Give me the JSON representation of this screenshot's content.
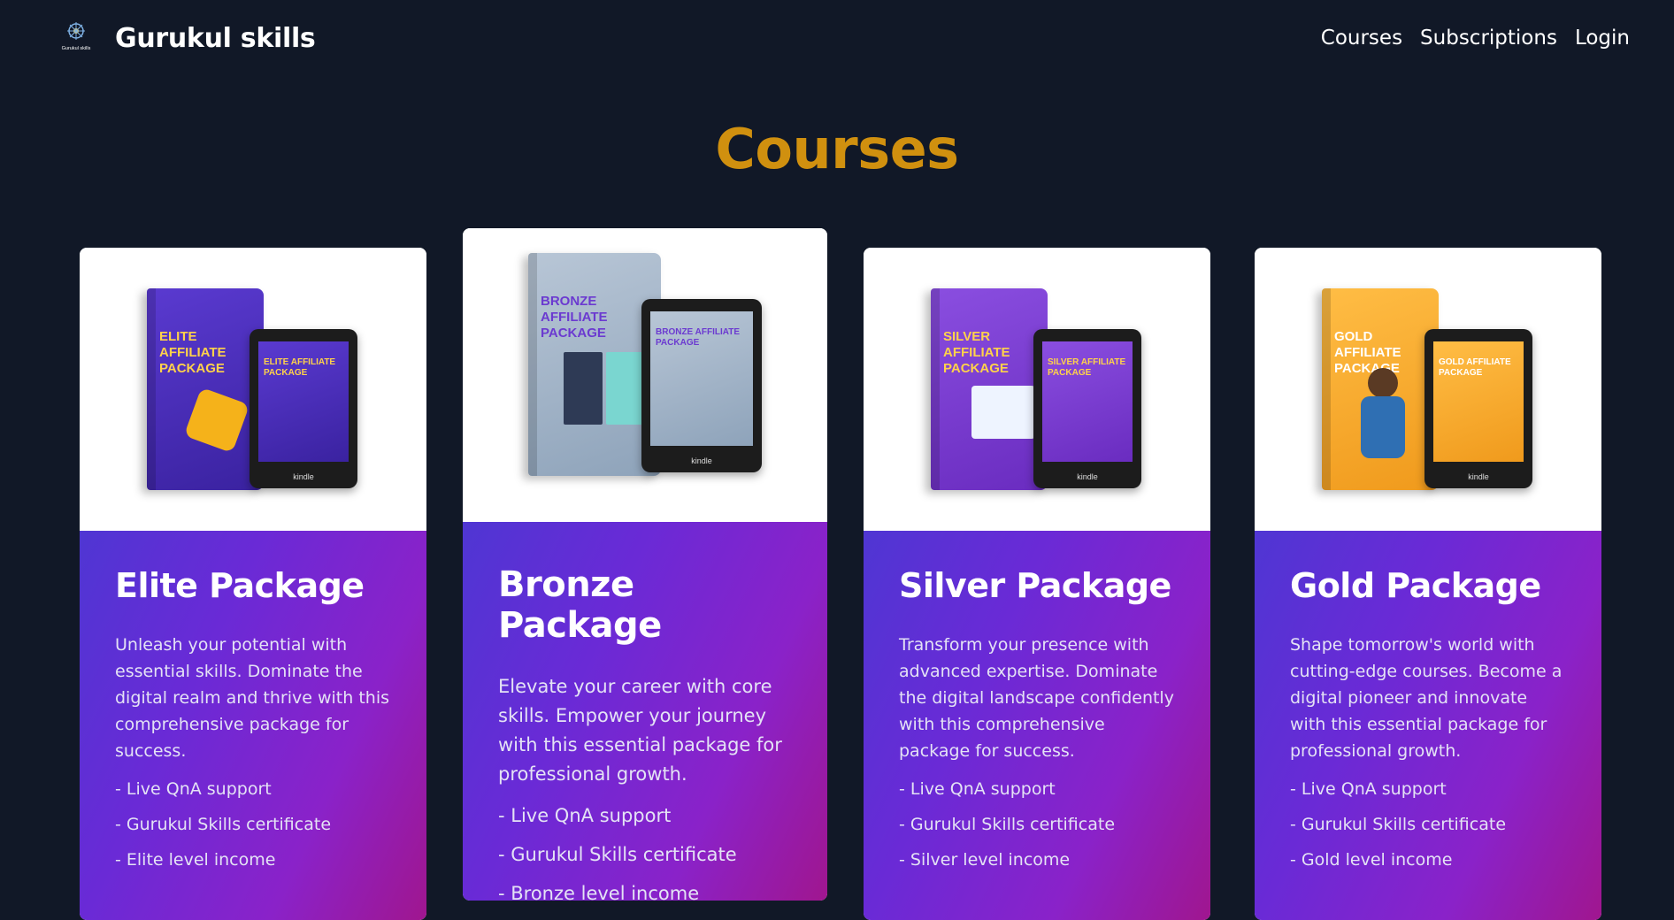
{
  "nav": {
    "brand": "Gurukul skills",
    "logo_text": "Gurukul skills",
    "links": [
      "Courses",
      "Subscriptions",
      "Login"
    ]
  },
  "page": {
    "title": "Courses"
  },
  "colors": {
    "background": "#111827",
    "title_accent": "#d0900f",
    "card_gradient_start": "#4f36d3",
    "card_gradient_end": "#a0168f"
  },
  "cards": [
    {
      "title": "Elite Package",
      "description": "Unleash your potential with essential skills. Dominate the digital realm and thrive with this comprehensive package for success.",
      "features": [
        "- Live QnA support",
        "- Gurukul Skills certificate",
        "- Elite level income"
      ],
      "product_label": "ELITE AFFILIATE PACKAGE",
      "device_label": "kindle",
      "box_color": "#4b2fb8"
    },
    {
      "title": "Bronze Package",
      "description": "Elevate your career with core skills. Empower your journey with this essential package for professional growth.",
      "features": [
        "- Live QnA support",
        "- Gurukul Skills certificate",
        "- Bronze level income"
      ],
      "product_label": "BRONZE AFFILIATE PACKAGE",
      "device_label": "kindle",
      "box_color": "#9fb3c8"
    },
    {
      "title": "Silver Package",
      "description": "Transform your presence with advanced expertise. Dominate the digital landscape confidently with this comprehensive package for success.",
      "features": [
        "- Live QnA support",
        "- Gurukul Skills certificate",
        "- Silver level income"
      ],
      "product_label": "SILVER AFFILIATE PACKAGE",
      "device_label": "kindle",
      "box_color": "#7a3fd0"
    },
    {
      "title": "Gold Package",
      "description": "Shape tomorrow's world with cutting-edge courses. Become a digital pioneer and innovate with this essential package for professional growth.",
      "features": [
        "- Live QnA support",
        "- Gurukul Skills certificate",
        "- Gold level income"
      ],
      "product_label": "GOLD AFFILIATE PACKAGE",
      "device_label": "kindle",
      "box_color": "#f4a930"
    }
  ]
}
